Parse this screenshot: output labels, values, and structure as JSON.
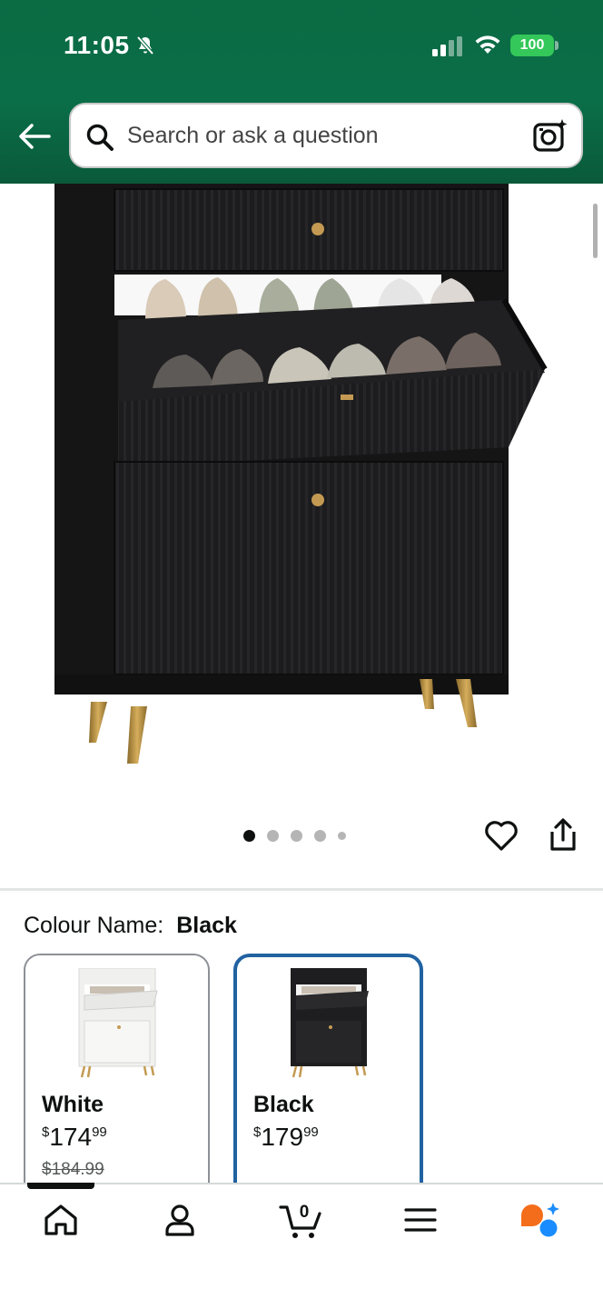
{
  "status_bar": {
    "time": "11:05",
    "battery": "100",
    "icons": [
      "bell-off-icon",
      "signal-icon",
      "wifi-icon",
      "battery-icon"
    ]
  },
  "header": {
    "back_icon": "arrow-left-icon",
    "search": {
      "placeholder": "Search or ask a question",
      "left_icon": "search-icon",
      "right_icon": "camera-lens-icon"
    },
    "colors": {
      "brand_green": "#0a6e48"
    }
  },
  "gallery": {
    "image_count": 5,
    "active_index": 0,
    "actions": [
      "heart-icon",
      "share-icon"
    ]
  },
  "variation": {
    "label": "Colour Name:",
    "selected": "Black",
    "options": [
      {
        "name": "White",
        "price_symbol": "$",
        "price_whole": "174",
        "price_fraction": "99",
        "was_price": "$184.99",
        "selected": false
      },
      {
        "name": "Black",
        "price_symbol": "$",
        "price_whole": "179",
        "price_fraction": "99",
        "selected": true
      }
    ],
    "colors": {
      "selected_border": "#2162a1"
    }
  },
  "bottom_nav": {
    "items": [
      "home-icon",
      "account-icon",
      "cart-icon",
      "menu-icon",
      "rufus-ai-icon"
    ],
    "cart_count": "0",
    "active": "home-icon"
  }
}
